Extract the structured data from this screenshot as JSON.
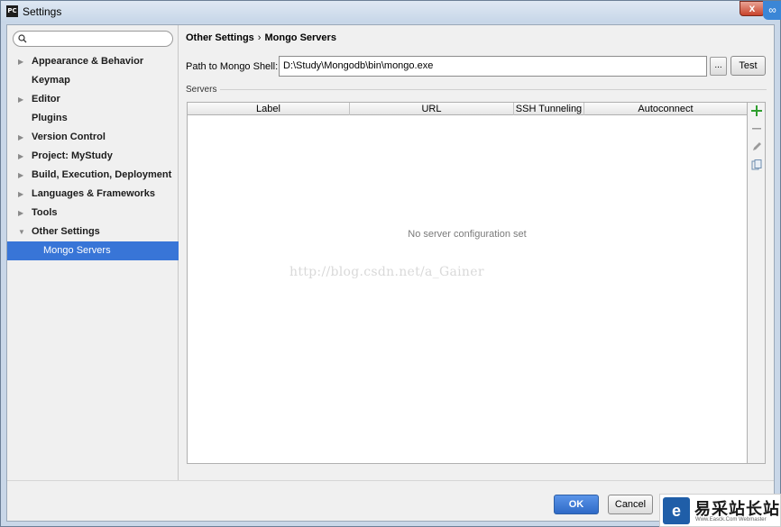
{
  "window": {
    "title": "Settings",
    "app_icon_text": "PC",
    "close_glyph": "x"
  },
  "search": {
    "placeholder": "",
    "icon": "search-icon"
  },
  "sidebar": {
    "items": [
      {
        "label": "Appearance & Behavior",
        "expandable": true,
        "expanded": false
      },
      {
        "label": "Keymap",
        "expandable": false
      },
      {
        "label": "Editor",
        "expandable": true,
        "expanded": false
      },
      {
        "label": "Plugins",
        "expandable": false
      },
      {
        "label": "Version Control",
        "expandable": true,
        "expanded": false
      },
      {
        "label": "Project: MyStudy",
        "expandable": true,
        "expanded": false
      },
      {
        "label": "Build, Execution, Deployment",
        "expandable": true,
        "expanded": false
      },
      {
        "label": "Languages & Frameworks",
        "expandable": true,
        "expanded": false
      },
      {
        "label": "Tools",
        "expandable": true,
        "expanded": false
      },
      {
        "label": "Other Settings",
        "expandable": true,
        "expanded": true
      },
      {
        "label": "Mongo Servers",
        "selected": true
      }
    ]
  },
  "breadcrumb": {
    "parent": "Other Settings",
    "separator": "›",
    "current": "Mongo Servers"
  },
  "mongo_shell": {
    "label": "Path to Mongo Shell:",
    "value": "D:\\Study\\Mongodb\\bin\\mongo.exe",
    "browse_label": "...",
    "test_label": "Test"
  },
  "servers": {
    "section_label": "Servers",
    "columns": [
      "Label",
      "URL",
      "SSH Tunneling",
      "Autoconnect"
    ],
    "empty_text": "No server configuration set",
    "watermark": "http://blog.csdn.net/a_Gainer",
    "tools": [
      "add-icon",
      "remove-icon",
      "edit-icon",
      "copy-icon"
    ]
  },
  "footer": {
    "ok_label": "OK",
    "cancel_label": "Cancel"
  },
  "logo": {
    "text": "易采站长站",
    "sub": "Www.Easck.Com Webmaster"
  },
  "colors": {
    "selection": "#3875d7",
    "ok_button": "#2f6ac7",
    "add_icon": "#2e9e2e"
  }
}
